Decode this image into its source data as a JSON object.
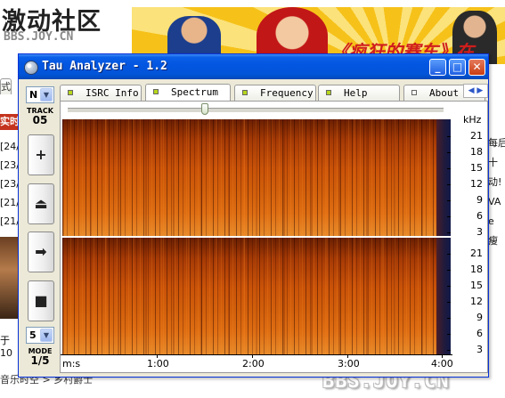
{
  "background_page": {
    "logo_cn": "激动社区",
    "logo_en": "BBS.JOY.CN",
    "banner_title": "《疯狂的赛车》在",
    "left_tab": "式",
    "left_red_tab": "实时",
    "left_news": [
      "[24/",
      "[23/",
      "[23/",
      "[21/",
      "[21/"
    ],
    "left_bottom": "于10",
    "right_news": [
      "每后",
      "十",
      "动!",
      "VA",
      "e",
      "瘦"
    ],
    "bottom_text": "音乐时空 > 乡村爵士",
    "watermark": "BBS.JOY.CN"
  },
  "window": {
    "title": "Tau Analyzer - 1.2",
    "minimize": "_",
    "maximize": "□",
    "close": "✕"
  },
  "controls": {
    "channel_select": "N",
    "track_label": "TRACK",
    "track_value": "05",
    "buttons": [
      {
        "name": "add",
        "glyph": "+"
      },
      {
        "name": "eject",
        "glyph": "⏏"
      },
      {
        "name": "next",
        "glyph": "➡"
      },
      {
        "name": "stop",
        "glyph": "■"
      }
    ],
    "mode_select": "5",
    "mode_label": "MODE",
    "mode_value": "1/5"
  },
  "tabs": [
    {
      "label": "ISRC Info",
      "active": false,
      "led_color": "#555555"
    },
    {
      "label": "Spectrum",
      "active": true,
      "led_color": "#b6d61a"
    },
    {
      "label": "Frequency",
      "active": false,
      "led_color": "#b6d61a"
    },
    {
      "label": "Help",
      "active": false,
      "led_color": "#b6d61a"
    },
    {
      "label": "About",
      "active": false,
      "led_color": "#b6d61a"
    }
  ],
  "tab_scroll": "◀ ▶",
  "spectrogram": {
    "unit_label": "kHz",
    "channels": 2,
    "freq_ticks": [
      "21",
      "18",
      "15",
      "12",
      "9",
      "6",
      "3"
    ],
    "time_axis_label": "m:s",
    "time_ticks": [
      "1:00",
      "2:00",
      "3:00",
      "4:00"
    ],
    "colors": {
      "low": "#6a1f02",
      "mid": "#c95208",
      "high": "#e78a2a",
      "beyond": "#131a4a"
    }
  }
}
